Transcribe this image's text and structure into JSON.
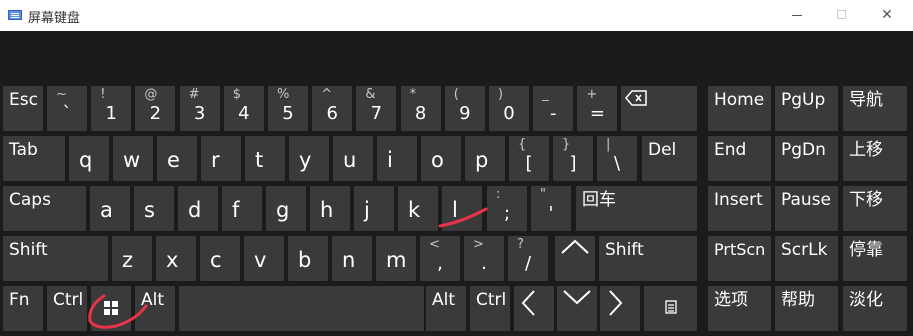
{
  "window": {
    "title": "屏幕键盘"
  },
  "keys": {
    "esc": "Esc",
    "r1": [
      {
        "shift": "~",
        "base": "`"
      },
      {
        "shift": "!",
        "base": "1"
      },
      {
        "shift": "@",
        "base": "2"
      },
      {
        "shift": "#",
        "base": "3"
      },
      {
        "shift": "$",
        "base": "4"
      },
      {
        "shift": "%",
        "base": "5"
      },
      {
        "shift": "^",
        "base": "6"
      },
      {
        "shift": "&",
        "base": "7"
      },
      {
        "shift": "*",
        "base": "8"
      },
      {
        "shift": "(",
        "base": "9"
      },
      {
        "shift": ")",
        "base": "0"
      },
      {
        "shift": "_",
        "base": "-"
      },
      {
        "shift": "+",
        "base": "="
      }
    ],
    "backspace": "backspace-icon",
    "home": "Home",
    "pgup": "PgUp",
    "nav": "导航",
    "tab": "Tab",
    "r2": [
      "q",
      "w",
      "e",
      "r",
      "t",
      "y",
      "u",
      "i",
      "o",
      "p"
    ],
    "r2sym": [
      {
        "shift": "{",
        "base": "["
      },
      {
        "shift": "}",
        "base": "]"
      },
      {
        "shift": "|",
        "base": "\\"
      }
    ],
    "del": "Del",
    "end": "End",
    "pgdn": "PgDn",
    "moveup": "上移",
    "caps": "Caps",
    "r3": [
      "a",
      "s",
      "d",
      "f",
      "g",
      "h",
      "j",
      "k",
      "l"
    ],
    "r3sym": [
      {
        "shift": ":",
        "base": ";"
      },
      {
        "shift": "\"",
        "base": "'"
      }
    ],
    "enter": "回车",
    "insert": "Insert",
    "pause": "Pause",
    "movedown": "下移",
    "shift_l": "Shift",
    "r4": [
      "z",
      "x",
      "c",
      "v",
      "b",
      "n",
      "m"
    ],
    "r4sym": [
      {
        "shift": "<",
        "base": ","
      },
      {
        "shift": ">",
        "base": "."
      },
      {
        "shift": "?",
        "base": "/"
      }
    ],
    "up_arrow": "up-arrow-icon",
    "shift_r": "Shift",
    "prtscn": "PrtScn",
    "scrlk": "ScrLk",
    "dock": "停靠",
    "fn": "Fn",
    "ctrl_l": "Ctrl",
    "win": "windows-icon",
    "alt_l": "Alt",
    "alt_r": "Alt",
    "ctrl_r": "Ctrl",
    "left_arrow": "left-arrow-icon",
    "down_arrow": "down-arrow-icon",
    "right_arrow": "right-arrow-icon",
    "menu": "menu-icon",
    "options": "选项",
    "help": "帮助",
    "fade": "淡化"
  },
  "colors": {
    "key": "#3a3a3a",
    "background": "#1b1b1b",
    "annotation": "#e8334a"
  }
}
